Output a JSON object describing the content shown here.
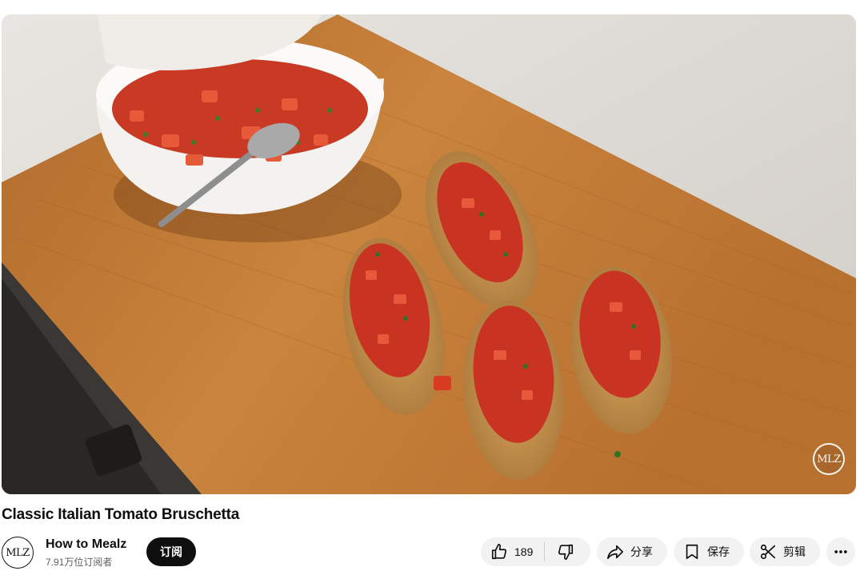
{
  "video": {
    "title": "Classic Italian Tomato Bruschetta",
    "watermark": "MLZ"
  },
  "channel": {
    "avatar_text": "MLZ",
    "name": "How to Mealz",
    "subscribers": "7.91万位订阅者",
    "subscribe_label": "订阅"
  },
  "actions": {
    "like_count": "189",
    "share_label": "分享",
    "save_label": "保存",
    "clip_label": "剪辑"
  },
  "icons": [
    "thumbs-up-icon",
    "thumbs-down-icon",
    "share-icon",
    "bookmark-icon",
    "scissors-icon",
    "more-icon"
  ],
  "colors": {
    "subscribe_bg": "#0f0f0f",
    "pill_bg": "#f2f2f2",
    "secondary_text": "#606060"
  }
}
